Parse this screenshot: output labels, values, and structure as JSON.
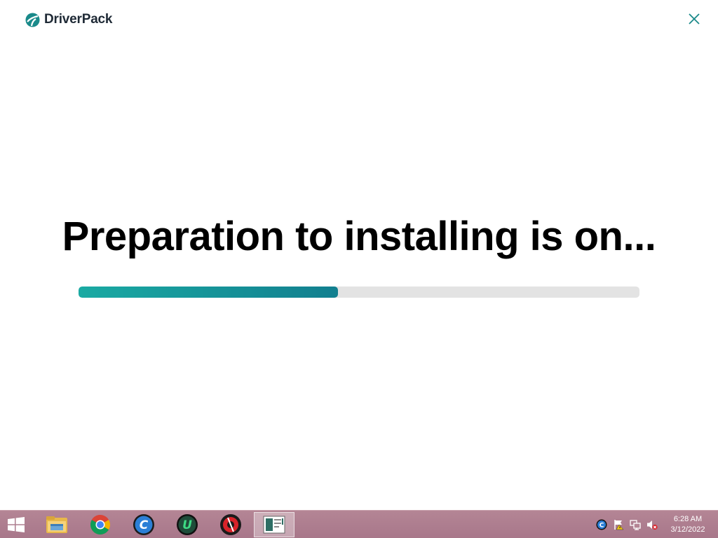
{
  "app": {
    "brand_name": "DriverPack",
    "brand_color": "#1a8a8a"
  },
  "main": {
    "headline": "Preparation to installing is on...",
    "progress_fraction": 0.463,
    "progress_color_start": "#1aaaa3",
    "progress_color_end": "#127f8f"
  },
  "taskbar": {
    "pinned_apps": [
      {
        "name": "file-explorer-icon"
      },
      {
        "name": "chrome-icon"
      },
      {
        "name": "ccleaner-icon"
      },
      {
        "name": "uvpn-icon"
      },
      {
        "name": "red-tool-icon"
      },
      {
        "name": "driverpack-taskbar-icon",
        "active": true
      }
    ],
    "tray_icons": [
      "ccleaner-tray-icon",
      "action-center-flag-icon",
      "network-icon",
      "volume-muted-icon"
    ],
    "clock": {
      "time": "6:28 AM",
      "date": "3/12/2022"
    }
  }
}
